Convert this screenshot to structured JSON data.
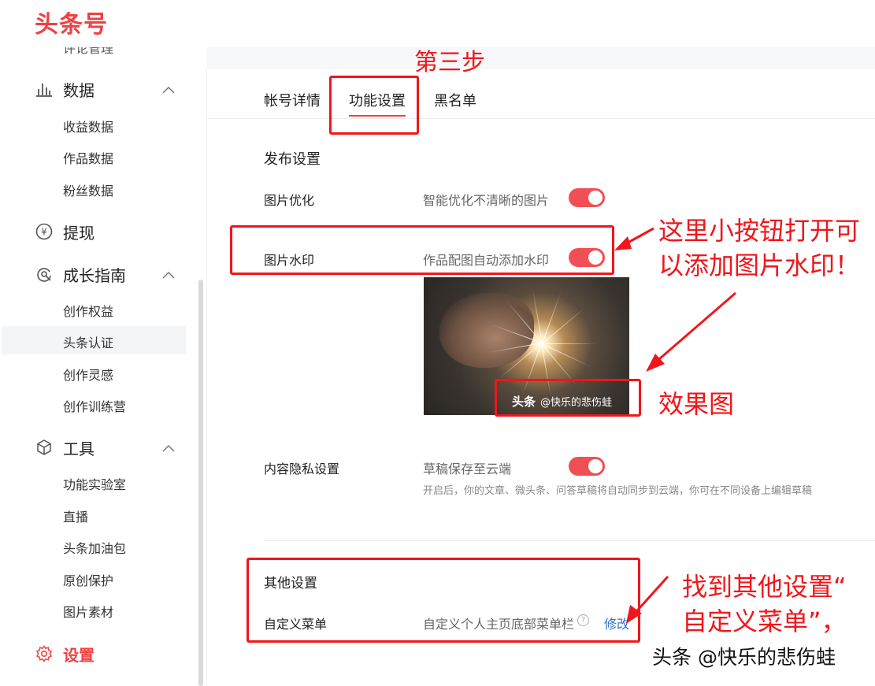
{
  "brand": {
    "logo_text": "头条号",
    "accent": "#f04142"
  },
  "sidebar": {
    "cut_item": "评论管理",
    "sections": [
      {
        "label": "数据",
        "icon": "bar-chart-icon",
        "expanded": true,
        "items": [
          "收益数据",
          "作品数据",
          "粉丝数据"
        ]
      },
      {
        "label": "提现",
        "icon": "yen-circle-icon"
      },
      {
        "label": "成长指南",
        "icon": "growth-icon",
        "expanded": true,
        "items": [
          "创作权益",
          "头条认证",
          "创作灵感",
          "创作训练营"
        ],
        "active_item": "头条认证"
      },
      {
        "label": "工具",
        "icon": "cube-icon",
        "expanded": true,
        "items": [
          "功能实验室",
          "直播",
          "头条加油包",
          "原创保护",
          "图片素材"
        ]
      },
      {
        "label": "设置",
        "icon": "gear-icon",
        "active": true
      }
    ]
  },
  "tabs": [
    {
      "label": "帐号详情"
    },
    {
      "label": "功能设置",
      "active": true
    },
    {
      "label": "黑名单"
    }
  ],
  "publish_settings": {
    "title": "发布设置",
    "image_optimize": {
      "label": "图片优化",
      "desc": "智能优化不清晰的图片",
      "enabled": true
    },
    "image_watermark": {
      "label": "图片水印",
      "desc": "作品配图自动添加水印",
      "enabled": true
    },
    "watermark_preview": {
      "brand": "头条",
      "handle": "@快乐的悲伤蛙"
    },
    "content_privacy": {
      "label": "内容隐私设置",
      "desc": "草稿保存至云端",
      "enabled": true,
      "note": "开启后，你的文章、微头条、问答草稿将自动同步到云端，你可在不同设备上编辑草稿"
    }
  },
  "other_settings": {
    "title": "其他设置",
    "custom_menu": {
      "label": "自定义菜单",
      "desc": "自定义个人主页底部菜单栏",
      "help": "?",
      "action": "修改"
    }
  },
  "annotations": {
    "step3": "第三步",
    "toggle_hint_line1": "这里小按钮打开可",
    "toggle_hint_line2": "以添加图片水印！",
    "effect": "效果图",
    "find_line1": "找到其他设置“",
    "find_line2": "自定义菜单”，",
    "color": "#f0161b"
  },
  "footer_watermark": "头条 @快乐的悲伤蛙"
}
